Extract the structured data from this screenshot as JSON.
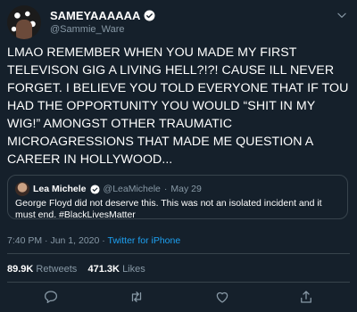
{
  "author": {
    "display_name": "SAMEYAAAAAA",
    "handle": "@Sammie_Ware"
  },
  "tweet": {
    "text": "LMAO REMEMBER WHEN YOU MADE MY FIRST\nTELEVISON GIG A LIVING HELL?!?! CAUSE ILL NEVER\nFORGET. I BELIEVE YOU TOLD EVERYONE THAT IF TOU\nHAD THE OPPORTUNITY YOU WOULD “SHIT IN MY\nWIG!” AMONGST OTHER TRAUMATIC\nMICROAGRESSIONS THAT MADE ME QUESTION A\nCAREER IN HOLLYWOOD...",
    "time": "7:40 PM",
    "date": "Jun 1, 2020",
    "separator": "·",
    "source": "Twitter for iPhone"
  },
  "quoted_tweet": {
    "display_name": "Lea Michele",
    "handle": "@LeaMichele",
    "dot": "·",
    "date": "May 29",
    "text": "George Floyd did not deserve this. This was not an isolated incident and it must end. #BlackLivesMatter"
  },
  "stats": {
    "retweets_count": "89.9K",
    "retweets_label": "Retweets",
    "likes_count": "471.3K",
    "likes_label": "Likes"
  },
  "icons": {
    "reply": "reply-icon",
    "retweet": "retweet-icon",
    "like": "like-icon",
    "share": "share-icon",
    "more": "chevron-down-icon",
    "verified": "verified-badge-icon"
  },
  "colors": {
    "background": "#15202b",
    "accent": "#1da1f2",
    "muted_text": "#8899a6",
    "border": "#38444d"
  }
}
